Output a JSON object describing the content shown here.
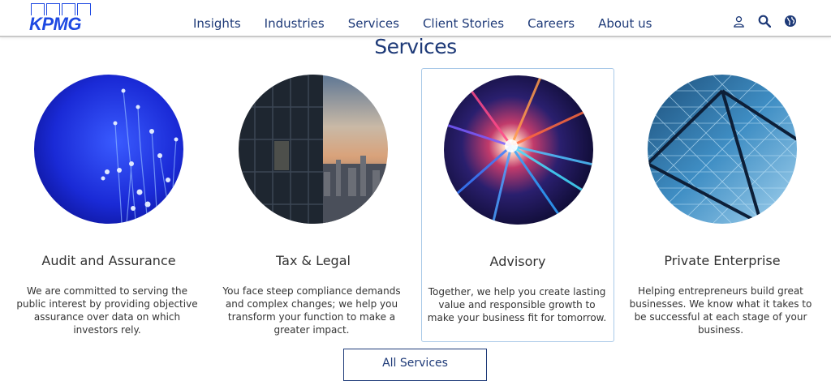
{
  "brand": {
    "logo_text": "KPMG",
    "color": "#1e49e2",
    "navy": "#1e3a78"
  },
  "nav": {
    "items": [
      "Insights",
      "Industries",
      "Services",
      "Client Stories",
      "Careers",
      "About us"
    ]
  },
  "header_icons": [
    "user-icon",
    "search-icon",
    "globe-icon"
  ],
  "section": {
    "title": "Services"
  },
  "cards": [
    {
      "title": "Audit and Assurance",
      "description": "We are committed to serving the public interest by providing objective assurance over data on which investors rely.",
      "image": "fiber-optics"
    },
    {
      "title": "Tax & Legal",
      "description": "You face steep compliance demands and complex changes; we help you transform your function to make a greater impact.",
      "image": "city-skyline"
    },
    {
      "title": "Advisory",
      "description": "Together, we help you create lasting value and responsible growth to make your business fit for tomorrow.",
      "image": "light-burst"
    },
    {
      "title": "Private Enterprise",
      "description": "Helping entrepreneurs build great businesses. We know what it takes to be successful at each stage of your business.",
      "image": "glass-structure"
    }
  ],
  "all_services_button": "All Services"
}
